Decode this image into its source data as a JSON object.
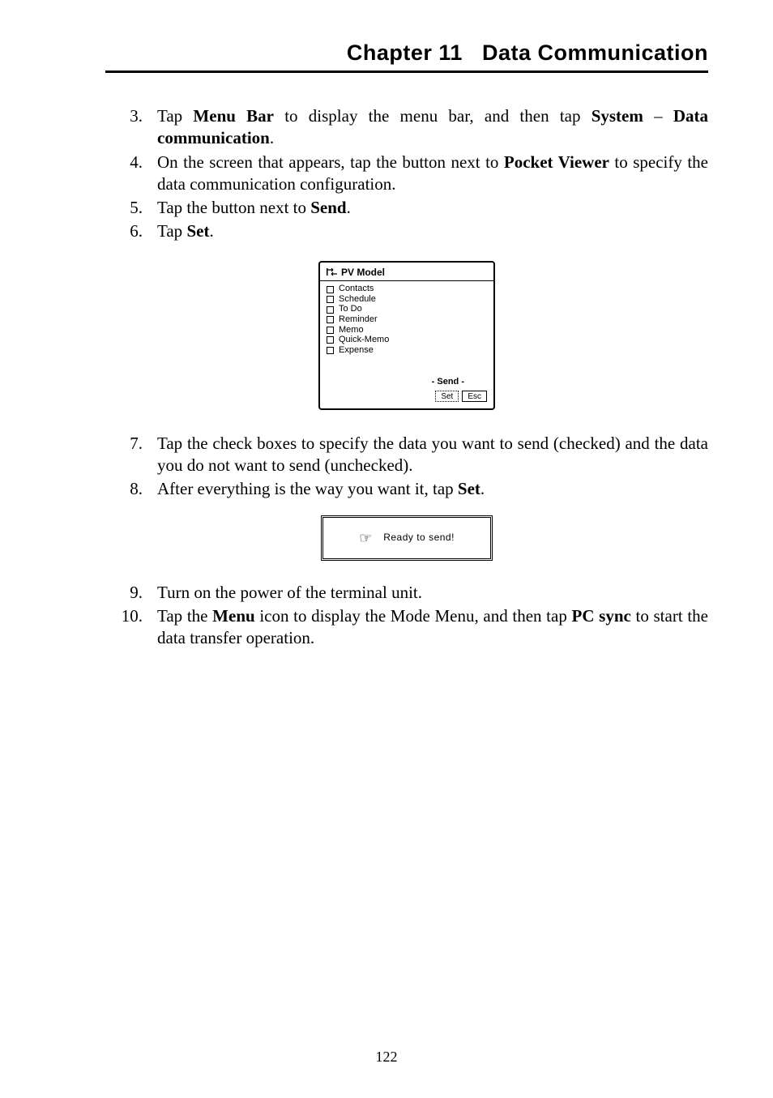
{
  "header": {
    "chapter": "Chapter 11",
    "title": "Data Communication"
  },
  "steps": {
    "s3": {
      "num": "3.",
      "pre": "Tap ",
      "bold1": "Menu Bar",
      "mid1": " to display the menu bar, and then tap ",
      "bold2": "System",
      "mid2": " – ",
      "bold3": "Data communication",
      "post": "."
    },
    "s4": {
      "num": "4.",
      "pre": "On the screen that appears, tap the button next to ",
      "bold1": "Pocket Viewer",
      "post": " to specify the data communication configuration."
    },
    "s5": {
      "num": "5.",
      "pre": "Tap the button next to ",
      "bold1": "Send",
      "post": "."
    },
    "s6": {
      "num": "6.",
      "pre": "Tap ",
      "bold1": "Set",
      "post": "."
    },
    "s7": {
      "num": "7.",
      "text": "Tap the check boxes to specify the data you want to send (checked) and the data you do not want to send (unchecked)."
    },
    "s8": {
      "num": "8.",
      "pre": "After everything is the way you want it, tap ",
      "bold1": "Set",
      "post": "."
    },
    "s9": {
      "num": "9.",
      "text": "Turn on the power of the terminal unit."
    },
    "s10": {
      "num": "10.",
      "pre": "Tap the ",
      "bold1": "Menu",
      "mid1": " icon to display the Mode Menu, and then tap ",
      "bold2": "PC sync",
      "post": " to start the data transfer operation."
    }
  },
  "figure1": {
    "title": "PV Model",
    "options": [
      "Contacts",
      "Schedule",
      "To Do",
      "Reminder",
      "Memo",
      "Quick-Memo",
      "Expense"
    ],
    "modeLabel": "- Send -",
    "setBtn": "Set",
    "escBtn": "Esc"
  },
  "figure2": {
    "message": "Ready to send!"
  },
  "pageNumber": "122"
}
